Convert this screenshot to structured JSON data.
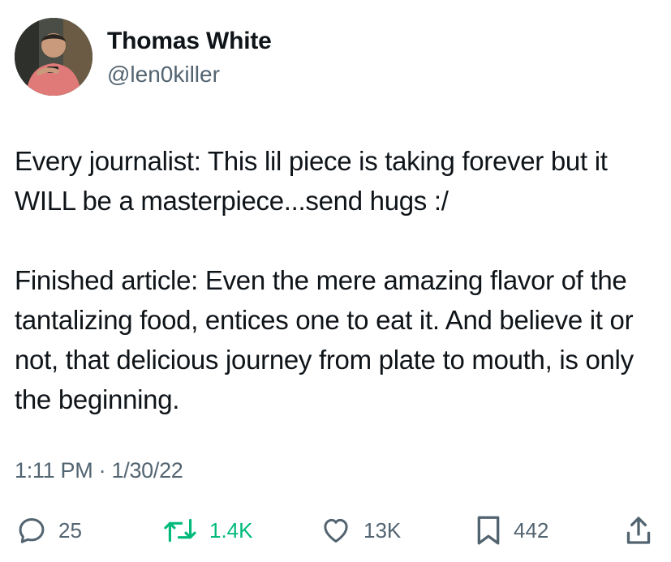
{
  "author": {
    "display_name": "Thomas White",
    "handle": "@len0killer",
    "avatar_icon": "profile-photo"
  },
  "tweet": {
    "paragraphs": [
      "Every journalist: This lil piece is taking forever but it WILL be a masterpiece...send hugs :/",
      "Finished article: Even the mere amazing flavor of the tantalizing food, entices one to eat it. And believe it or not, that delicious journey from plate to mouth, is only the beginning."
    ],
    "timestamp": "1:11 PM · 1/30/22"
  },
  "actions": {
    "reply": {
      "icon": "reply-icon",
      "count": "25"
    },
    "retweet": {
      "icon": "retweet-icon",
      "count": "1.4K",
      "color": "#00ba7c"
    },
    "like": {
      "icon": "heart-icon",
      "count": "13K"
    },
    "bookmark": {
      "icon": "bookmark-icon",
      "count": "442"
    },
    "share": {
      "icon": "share-icon"
    }
  },
  "colors": {
    "text": "#0f1419",
    "secondary": "#536471",
    "retweet_accent": "#00ba7c"
  }
}
